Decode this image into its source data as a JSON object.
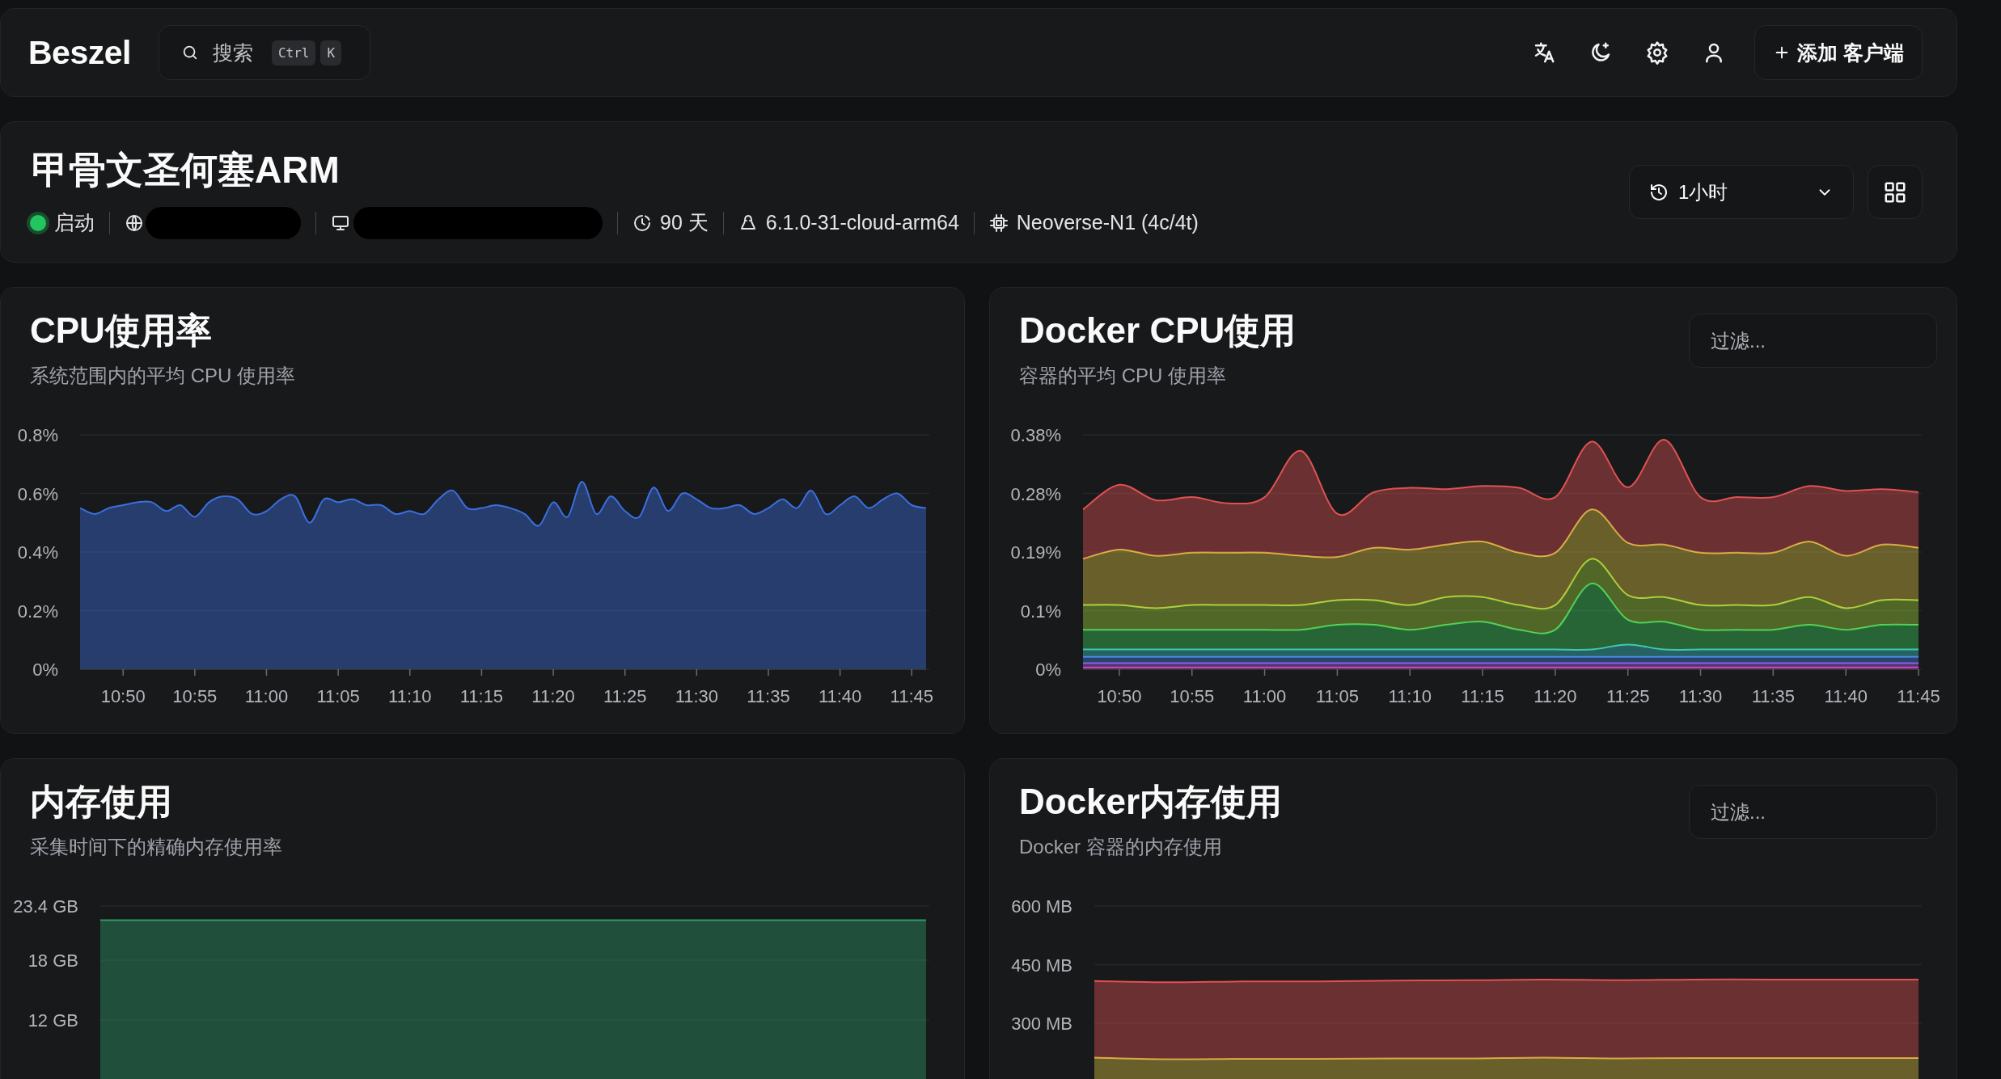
{
  "app": {
    "logo": "Beszel"
  },
  "search": {
    "placeholder": "搜索",
    "shortcut": [
      "Ctrl",
      "K"
    ]
  },
  "add_button": {
    "label": "添加 客户端"
  },
  "system": {
    "name": "甲骨文圣何塞ARM",
    "info": [
      {
        "kind": "status",
        "up": true,
        "label": "启动"
      },
      {
        "kind": "address",
        "redacted": true
      },
      {
        "kind": "host",
        "redacted": true
      },
      {
        "kind": "uptime",
        "label": "90 天"
      },
      {
        "kind": "kernel",
        "label": "6.1.0-31-cloud-arm64"
      },
      {
        "kind": "cpu",
        "label": "Neoverse-N1 (4c/4t)"
      }
    ]
  },
  "time_range": {
    "value": "1小时"
  },
  "charts": [
    {
      "title": "CPU使用率",
      "subtitle": "系统范围内的平均 CPU 使用率",
      "chart_data": {
        "type": "area",
        "stacked": false,
        "grid": true,
        "categories": [
          null,
          null,
          null,
          "10:50",
          null,
          null,
          null,
          null,
          "10:55",
          null,
          null,
          null,
          null,
          "11:00",
          null,
          null,
          null,
          null,
          "11:05",
          null,
          null,
          null,
          null,
          "11:10",
          null,
          null,
          null,
          null,
          "11:15",
          null,
          null,
          null,
          null,
          "11:20",
          null,
          null,
          null,
          null,
          "11:25",
          null,
          null,
          null,
          null,
          "11:30",
          null,
          null,
          null,
          null,
          "11:35",
          null,
          null,
          null,
          null,
          "11:40",
          null,
          null,
          null,
          null,
          "11:45",
          null
        ],
        "series": [
          {
            "color": "#3b6fe0",
            "values": [
              0.55,
              0.53,
              0.55,
              0.56,
              0.57,
              0.57,
              0.54,
              0.56,
              0.52,
              0.57,
              0.59,
              0.58,
              0.53,
              0.54,
              0.58,
              0.59,
              0.5,
              0.58,
              0.57,
              0.58,
              0.56,
              0.56,
              0.53,
              0.54,
              0.53,
              0.58,
              0.61,
              0.55,
              0.55,
              0.56,
              0.55,
              0.53,
              0.49,
              0.57,
              0.52,
              0.64,
              0.53,
              0.59,
              0.54,
              0.52,
              0.62,
              0.54,
              0.6,
              0.58,
              0.55,
              0.55,
              0.56,
              0.53,
              0.55,
              0.58,
              0.55,
              0.61,
              0.53,
              0.56,
              0.59,
              0.55,
              0.58,
              0.6,
              0.56,
              0.55
            ]
          }
        ],
        "ylim": [
          0,
          0.8
        ],
        "yticks": [
          {
            "value": 0,
            "label": "0%"
          },
          {
            "value": 0.2,
            "label": "0.2%"
          },
          {
            "value": 0.4,
            "label": "0.4%"
          },
          {
            "value": 0.6,
            "label": "0.6%"
          },
          {
            "value": 0.8,
            "label": "0.8%"
          }
        ]
      }
    },
    {
      "title": "Docker CPU使用",
      "subtitle": "容器的平均 CPU 使用率",
      "filter": {
        "placeholder": "过滤..."
      },
      "chart_data": {
        "type": "area",
        "stacked": true,
        "grid": true,
        "categories": [
          null,
          "10:50",
          null,
          "10:55",
          null,
          "11:00",
          null,
          "11:05",
          null,
          "11:10",
          null,
          "11:15",
          null,
          "11:20",
          null,
          "11:25",
          null,
          "11:30",
          null,
          "11:35",
          null,
          "11:40",
          null,
          "11:45"
        ],
        "series": [
          {
            "color": "#e040c0",
            "values": [
              0.003,
              0.003,
              0.003,
              0.003,
              0.003,
              0.003,
              0.003,
              0.003,
              0.003,
              0.003,
              0.003,
              0.003,
              0.003,
              0.003,
              0.003,
              0.003,
              0.003,
              0.003,
              0.003,
              0.003,
              0.003,
              0.003,
              0.003,
              0.003
            ]
          },
          {
            "color": "#9c5ae0",
            "values": [
              0.007,
              0.007,
              0.007,
              0.007,
              0.007,
              0.007,
              0.007,
              0.007,
              0.007,
              0.007,
              0.007,
              0.007,
              0.007,
              0.007,
              0.007,
              0.007,
              0.007,
              0.007,
              0.007,
              0.007,
              0.007,
              0.007,
              0.007,
              0.007
            ]
          },
          {
            "color": "#4a7be0",
            "values": [
              0.01,
              0.01,
              0.01,
              0.01,
              0.01,
              0.01,
              0.01,
              0.01,
              0.01,
              0.01,
              0.01,
              0.01,
              0.01,
              0.01,
              0.01,
              0.01,
              0.01,
              0.01,
              0.01,
              0.01,
              0.01,
              0.01,
              0.01,
              0.01
            ]
          },
          {
            "color": "#3fc7c7",
            "values": [
              0.012,
              0.012,
              0.012,
              0.012,
              0.012,
              0.012,
              0.012,
              0.012,
              0.012,
              0.012,
              0.012,
              0.012,
              0.012,
              0.012,
              0.012,
              0.02,
              0.012,
              0.012,
              0.012,
              0.012,
              0.012,
              0.012,
              0.012,
              0.012
            ]
          },
          {
            "color": "#3ecf5e",
            "values": [
              0.032,
              0.032,
              0.032,
              0.032,
              0.032,
              0.032,
              0.032,
              0.04,
              0.04,
              0.032,
              0.04,
              0.045,
              0.032,
              0.032,
              0.107,
              0.04,
              0.045,
              0.032,
              0.032,
              0.032,
              0.04,
              0.032,
              0.04,
              0.04
            ]
          },
          {
            "color": "#a3d43b",
            "values": [
              0.04,
              0.04,
              0.035,
              0.04,
              0.04,
              0.04,
              0.04,
              0.04,
              0.04,
              0.04,
              0.045,
              0.04,
              0.04,
              0.04,
              0.04,
              0.04,
              0.04,
              0.04,
              0.04,
              0.04,
              0.045,
              0.035,
              0.04,
              0.04
            ]
          },
          {
            "color": "#d9c042",
            "values": [
              0.075,
              0.09,
              0.085,
              0.085,
              0.085,
              0.085,
              0.08,
              0.07,
              0.085,
              0.09,
              0.085,
              0.09,
              0.085,
              0.085,
              0.08,
              0.085,
              0.085,
              0.085,
              0.085,
              0.085,
              0.09,
              0.085,
              0.09,
              0.085
            ]
          },
          {
            "color": "#e05252",
            "values": [
              0.08,
              0.105,
              0.09,
              0.09,
              0.08,
              0.09,
              0.17,
              0.07,
              0.09,
              0.1,
              0.09,
              0.09,
              0.105,
              0.09,
              0.11,
              0.09,
              0.17,
              0.09,
              0.09,
              0.09,
              0.09,
              0.105,
              0.09,
              0.09
            ]
          }
        ],
        "ylim": [
          0,
          0.38
        ],
        "yticks": [
          {
            "value": 0,
            "label": "0%"
          },
          {
            "value": 0.095,
            "label": "0.1%"
          },
          {
            "value": 0.19,
            "label": "0.19%"
          },
          {
            "value": 0.285,
            "label": "0.28%"
          },
          {
            "value": 0.38,
            "label": "0.38%"
          }
        ]
      }
    },
    {
      "title": "内存使用",
      "subtitle": "采集时间下的精确内存使用率",
      "chart_data": {
        "type": "area",
        "stacked": false,
        "grid": true,
        "series": [
          {
            "color": "#2e9a68",
            "values": [
              22,
              22,
              22,
              22,
              22,
              22,
              22,
              22,
              22,
              22,
              22,
              22
            ]
          }
        ],
        "ylim": [
          0,
          23.4
        ],
        "yticks": [
          {
            "value": 12,
            "label": "12 GB"
          },
          {
            "value": 18,
            "label": "18 GB"
          },
          {
            "value": 23.4,
            "label": "23.4 GB"
          }
        ]
      }
    },
    {
      "title": "Docker内存使用",
      "subtitle": "Docker 容器的内存使用",
      "filter": {
        "placeholder": "过滤..."
      },
      "chart_data": {
        "type": "area",
        "stacked": true,
        "grid": true,
        "series": [
          {
            "color": "#d9c042",
            "values": [
              212,
              208,
              209,
              209,
              210,
              210,
              212,
              210,
              211,
              211,
              211,
              211
            ]
          },
          {
            "color": "#e05252",
            "values": [
              196,
              197,
              198,
              198,
              199,
              200,
              200,
              200,
              201,
              201,
              201,
              201
            ]
          }
        ],
        "ylim": [
          0,
          600
        ],
        "yticks": [
          {
            "value": 300,
            "label": "300 MB"
          },
          {
            "value": 450,
            "label": "450 MB"
          },
          {
            "value": 600,
            "label": "600 MB"
          }
        ]
      }
    }
  ]
}
